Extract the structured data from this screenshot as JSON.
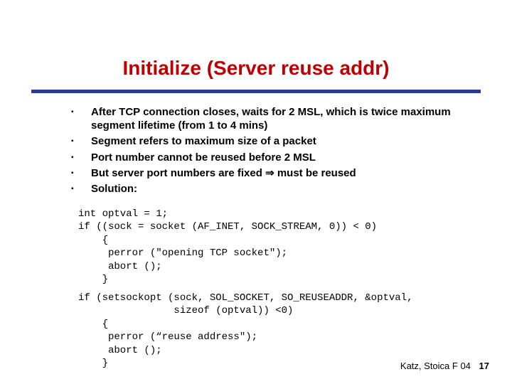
{
  "title": "Initialize (Server reuse addr)",
  "bullets": {
    "b1": "After TCP connection closes, waits for 2 MSL, which is twice maximum segment lifetime (from 1 to 4 mins)",
    "b2": "Segment refers to maximum size of a packet",
    "b3": "Port number cannot be reused before 2 MSL",
    "b4_a": "But server port numbers are fixed ",
    "b4_arrow": "⇒",
    "b4_b": " must be reused",
    "b5": "Solution:"
  },
  "code1": "int optval = 1;\nif ((sock = socket (AF_INET, SOCK_STREAM, 0)) < 0)\n    {\n     perror (\"opening TCP socket\");\n     abort ();\n    }",
  "code2": "if (setsockopt (sock, SOL_SOCKET, SO_REUSEADDR, &optval,\n                sizeof (optval)) <0)\n    {\n     perror (“reuse address\");\n     abort ();\n    }",
  "footer": {
    "credit": "Katz, Stoica F 04",
    "page": "17"
  },
  "marker": "▪"
}
